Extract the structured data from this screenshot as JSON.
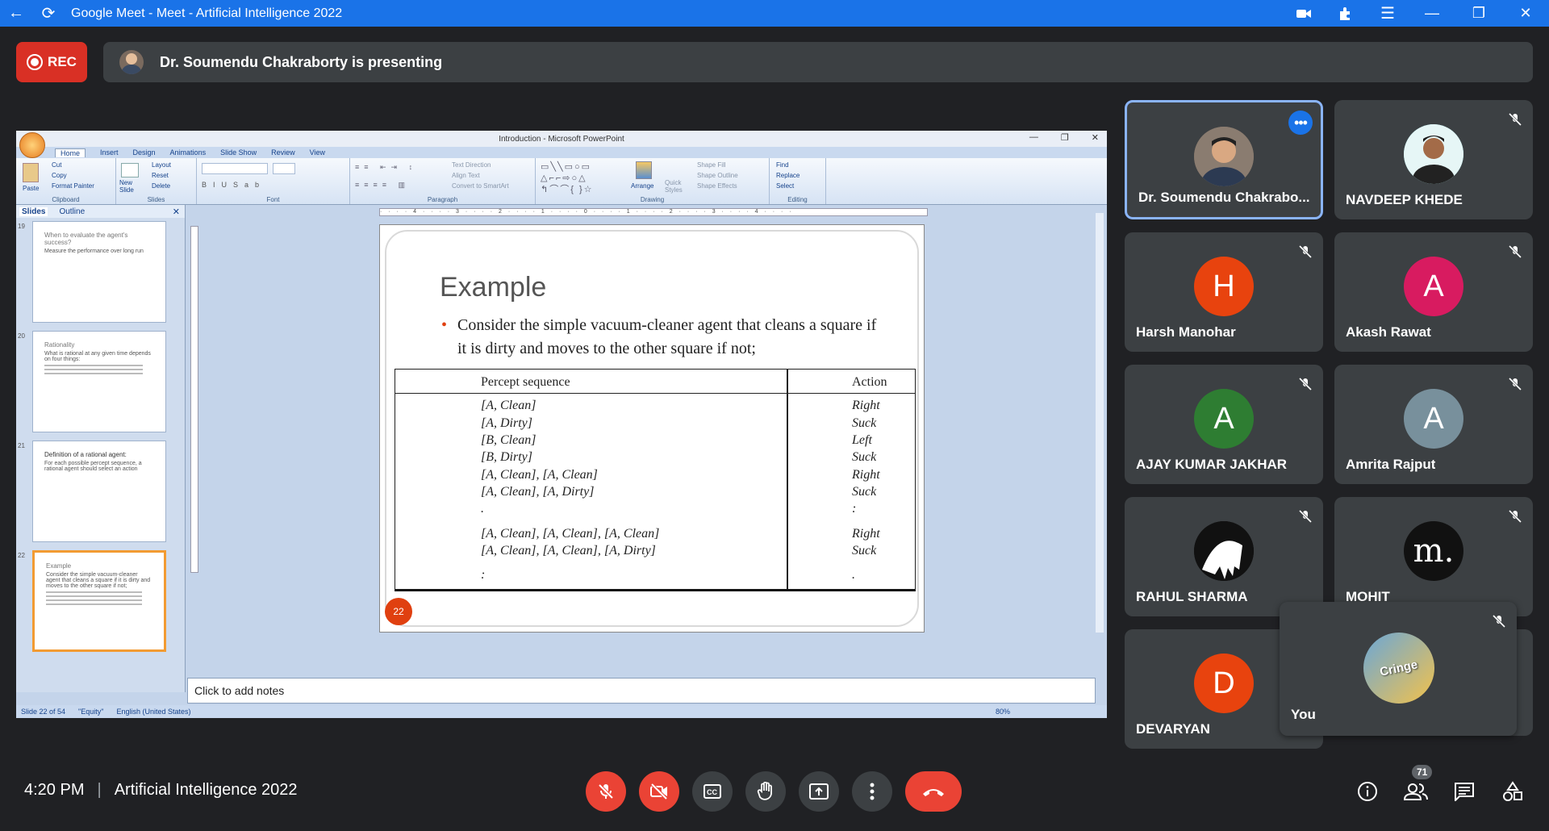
{
  "window": {
    "title": "Google Meet - Meet - Artificial Intelligence 2022"
  },
  "topbar": {
    "rec_label": "REC",
    "presenting_text": "Dr. Soumendu Chakraborty is presenting"
  },
  "ppt": {
    "title": "Introduction - Microsoft PowerPoint",
    "tabs": [
      "Home",
      "Insert",
      "Design",
      "Animations",
      "Slide Show",
      "Review",
      "View"
    ],
    "groups": {
      "clipboard": {
        "label": "Clipboard",
        "paste": "Paste",
        "cut": "Cut",
        "copy": "Copy",
        "format_painter": "Format Painter"
      },
      "slides": {
        "label": "Slides",
        "new_slide": "New Slide",
        "layout": "Layout",
        "reset": "Reset",
        "delete": "Delete"
      },
      "font": {
        "label": "Font"
      },
      "paragraph": {
        "label": "Paragraph",
        "text_direction": "Text Direction",
        "align_text": "Align Text",
        "convert": "Convert to SmartArt"
      },
      "drawing": {
        "label": "Drawing",
        "arrange": "Arrange",
        "quick_styles": "Quick Styles",
        "shape_fill": "Shape Fill",
        "shape_outline": "Shape Outline",
        "shape_effects": "Shape Effects"
      },
      "editing": {
        "label": "Editing",
        "find": "Find",
        "replace": "Replace",
        "select": "Select"
      }
    },
    "pane_tabs": {
      "slides": "Slides",
      "outline": "Outline"
    },
    "thumbnails": [
      {
        "num": "19",
        "title": "When to evaluate the agent's success?",
        "text": "Measure the performance over long run"
      },
      {
        "num": "20",
        "title": "Rationality",
        "text": "What is rational at any given time depends on four things:"
      },
      {
        "num": "21",
        "title": "Definition of a rational agent:",
        "text": "For each possible percept sequence, a rational agent should select an action"
      },
      {
        "num": "22",
        "title": "Example",
        "text": "Consider the simple vacuum-cleaner agent that cleans a square if it is dirty and moves to the other square if not;"
      }
    ],
    "slide": {
      "title": "Example",
      "bullet": "Consider the simple vacuum-cleaner agent that cleans a square if it is dirty and moves to the other square if not;",
      "header_percept": "Percept sequence",
      "header_action": "Action",
      "rows": [
        {
          "p": "[A, Clean]",
          "a": "Right"
        },
        {
          "p": "[A, Dirty]",
          "a": "Suck"
        },
        {
          "p": "[B, Clean]",
          "a": "Left"
        },
        {
          "p": "[B, Dirty]",
          "a": "Suck"
        },
        {
          "p": "[A, Clean], [A, Clean]",
          "a": "Right"
        },
        {
          "p": "[A, Clean], [A, Dirty]",
          "a": "Suck"
        },
        {
          "p": ".",
          "a": ":"
        },
        {
          "p": "[A, Clean], [A, Clean], [A, Clean]",
          "a": "Right"
        },
        {
          "p": "[A, Clean], [A, Clean], [A, Dirty]",
          "a": "Suck"
        },
        {
          "p": ":",
          "a": "."
        }
      ],
      "number": "22"
    },
    "notes_placeholder": "Click to add notes",
    "status": {
      "slide": "Slide 22 of 54",
      "theme": "\"Equity\"",
      "language": "English (United States)",
      "zoom": "80%"
    }
  },
  "participants": [
    {
      "name": "Dr. Soumendu Chakrabo...",
      "initial": "",
      "color": "#5f6368",
      "active": true
    },
    {
      "name": "NAVDEEP KHEDE",
      "initial": "",
      "color": "#4fc3c9",
      "muted": true
    },
    {
      "name": "Harsh Manohar",
      "initial": "H",
      "color": "#e8430e",
      "muted": true
    },
    {
      "name": "Akash Rawat",
      "initial": "A",
      "color": "#d81b60",
      "muted": true
    },
    {
      "name": "AJAY KUMAR JAKHAR",
      "initial": "A",
      "color": "#2e7d32",
      "muted": true
    },
    {
      "name": "Amrita Rajput",
      "initial": "A",
      "color": "#78909c",
      "muted": true
    },
    {
      "name": "RAHUL SHARMA",
      "initial": "",
      "color": "#111111",
      "muted": true
    },
    {
      "name": "MOHIT",
      "initial": "m.",
      "color": "#111111",
      "muted": true
    },
    {
      "name": "DEVARYAN",
      "initial": "D",
      "color": "#e8430e",
      "muted": false
    }
  ],
  "self": {
    "name": "You",
    "avatar_text": "Cringe"
  },
  "bottom": {
    "time": "4:20 PM",
    "meeting": "Artificial Intelligence 2022",
    "people_count": "71"
  }
}
